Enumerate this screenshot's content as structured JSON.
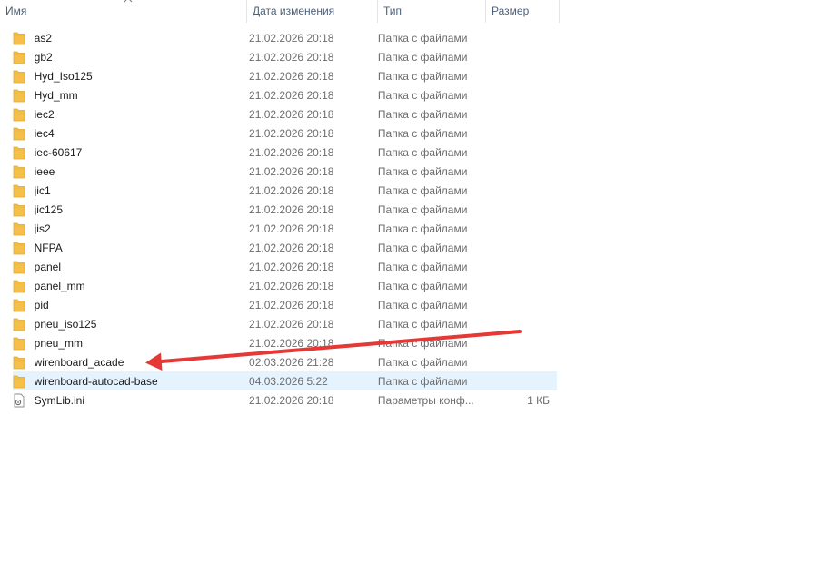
{
  "columns": {
    "name": "Имя",
    "date": "Дата изменения",
    "type": "Тип",
    "size": "Размер"
  },
  "colors": {
    "folder": "#f5c04a",
    "selected_row": "#e5f3ff",
    "arrow": "#e53935"
  },
  "files": [
    {
      "name": "as2",
      "date": "21.02.2026 20:18",
      "type": "Папка с файлами",
      "size": "",
      "icon": "folder-icon"
    },
    {
      "name": "gb2",
      "date": "21.02.2026 20:18",
      "type": "Папка с файлами",
      "size": "",
      "icon": "folder-icon"
    },
    {
      "name": "Hyd_Iso125",
      "date": "21.02.2026 20:18",
      "type": "Папка с файлами",
      "size": "",
      "icon": "folder-icon"
    },
    {
      "name": "Hyd_mm",
      "date": "21.02.2026 20:18",
      "type": "Папка с файлами",
      "size": "",
      "icon": "folder-icon"
    },
    {
      "name": "iec2",
      "date": "21.02.2026 20:18",
      "type": "Папка с файлами",
      "size": "",
      "icon": "folder-icon"
    },
    {
      "name": "iec4",
      "date": "21.02.2026 20:18",
      "type": "Папка с файлами",
      "size": "",
      "icon": "folder-icon"
    },
    {
      "name": "iec-60617",
      "date": "21.02.2026 20:18",
      "type": "Папка с файлами",
      "size": "",
      "icon": "folder-icon"
    },
    {
      "name": "ieee",
      "date": "21.02.2026 20:18",
      "type": "Папка с файлами",
      "size": "",
      "icon": "folder-icon"
    },
    {
      "name": "jic1",
      "date": "21.02.2026 20:18",
      "type": "Папка с файлами",
      "size": "",
      "icon": "folder-icon"
    },
    {
      "name": "jic125",
      "date": "21.02.2026 20:18",
      "type": "Папка с файлами",
      "size": "",
      "icon": "folder-icon"
    },
    {
      "name": "jis2",
      "date": "21.02.2026 20:18",
      "type": "Папка с файлами",
      "size": "",
      "icon": "folder-icon"
    },
    {
      "name": "NFPA",
      "date": "21.02.2026 20:18",
      "type": "Папка с файлами",
      "size": "",
      "icon": "folder-icon"
    },
    {
      "name": "panel",
      "date": "21.02.2026 20:18",
      "type": "Папка с файлами",
      "size": "",
      "icon": "folder-icon"
    },
    {
      "name": "panel_mm",
      "date": "21.02.2026 20:18",
      "type": "Папка с файлами",
      "size": "",
      "icon": "folder-icon"
    },
    {
      "name": "pid",
      "date": "21.02.2026 20:18",
      "type": "Папка с файлами",
      "size": "",
      "icon": "folder-icon"
    },
    {
      "name": "pneu_iso125",
      "date": "21.02.2026 20:18",
      "type": "Папка с файлами",
      "size": "",
      "icon": "folder-icon"
    },
    {
      "name": "pneu_mm",
      "date": "21.02.2026 20:18",
      "type": "Папка с файлами",
      "size": "",
      "icon": "folder-icon"
    },
    {
      "name": "wirenboard_acade",
      "date": "02.03.2026 21:28",
      "type": "Папка с файлами",
      "size": "",
      "icon": "folder-icon"
    },
    {
      "name": "wirenboard-autocad-base",
      "date": "04.03.2026 5:22",
      "type": "Папка с файлами",
      "size": "",
      "icon": "folder-icon",
      "selected": true
    },
    {
      "name": "SymLib.ini",
      "date": "21.02.2026 20:18",
      "type": "Параметры конф...",
      "size": "1 КБ",
      "icon": "settings-file-icon"
    }
  ]
}
